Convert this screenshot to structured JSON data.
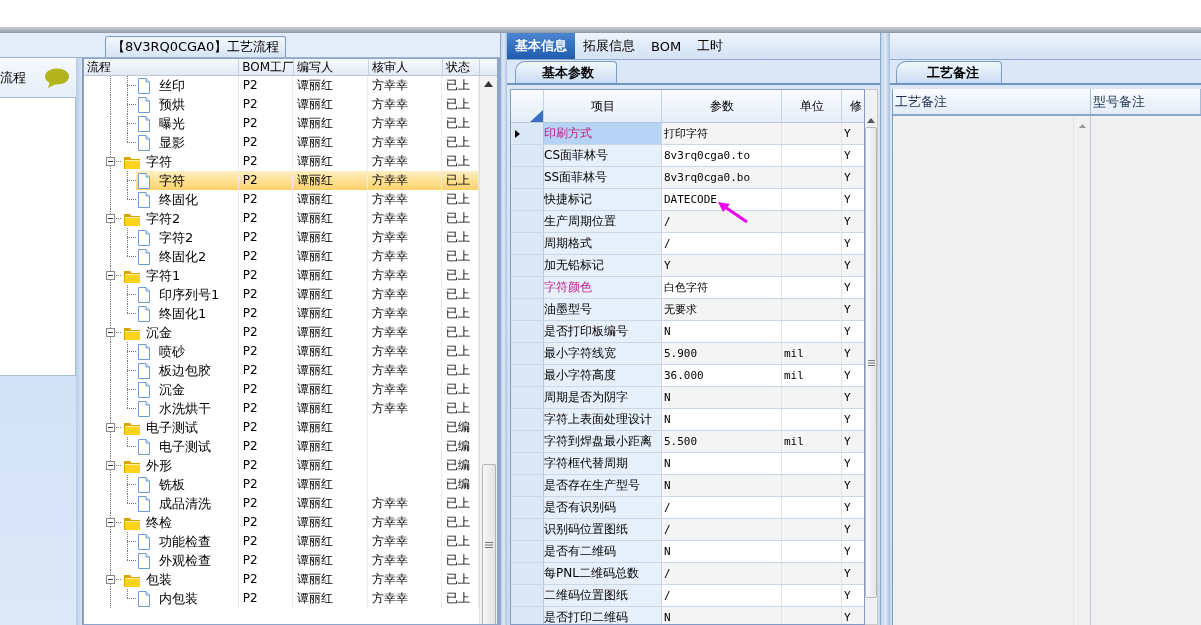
{
  "tree_tab": {
    "title": "【8V3RQ0CGA0】工艺流程"
  },
  "sidebar": {
    "title": "流程"
  },
  "tree": {
    "columns": [
      "流程",
      "BOM工厂",
      "编写人",
      "核审人",
      "状态"
    ],
    "rows": [
      {
        "kind": "continuation",
        "children": [
          {
            "label": "丝印",
            "factory": "P2",
            "writer": "谭丽红",
            "reviewer": "方幸幸",
            "status": "已上",
            "selected": false
          },
          {
            "label": "预烘",
            "factory": "P2",
            "writer": "谭丽红",
            "reviewer": "方幸幸",
            "status": "已上",
            "selected": false
          },
          {
            "label": "曝光",
            "factory": "P2",
            "writer": "谭丽红",
            "reviewer": "方幸幸",
            "status": "已上",
            "selected": false
          },
          {
            "label": "显影",
            "factory": "P2",
            "writer": "谭丽红",
            "reviewer": "方幸幸",
            "status": "已上",
            "selected": false
          }
        ]
      },
      {
        "kind": "folder",
        "label": "字符",
        "factory": "P2",
        "writer": "谭丽红",
        "reviewer": "方幸幸",
        "status": "已上",
        "selected": false,
        "children": [
          {
            "label": "字符",
            "factory": "P2",
            "writer": "谭丽红",
            "reviewer": "方幸幸",
            "status": "已上",
            "selected": true
          },
          {
            "label": "终固化",
            "factory": "P2",
            "writer": "谭丽红",
            "reviewer": "方幸幸",
            "status": "已上",
            "selected": false
          }
        ]
      },
      {
        "kind": "folder",
        "label": "字符2",
        "factory": "P2",
        "writer": "谭丽红",
        "reviewer": "方幸幸",
        "status": "已上",
        "selected": false,
        "children": [
          {
            "label": "字符2",
            "factory": "P2",
            "writer": "谭丽红",
            "reviewer": "方幸幸",
            "status": "已上",
            "selected": false
          },
          {
            "label": "终固化2",
            "factory": "P2",
            "writer": "谭丽红",
            "reviewer": "方幸幸",
            "status": "已上",
            "selected": false
          }
        ]
      },
      {
        "kind": "folder",
        "label": "字符1",
        "factory": "P2",
        "writer": "谭丽红",
        "reviewer": "方幸幸",
        "status": "已上",
        "selected": false,
        "children": [
          {
            "label": "印序列号1",
            "factory": "P2",
            "writer": "谭丽红",
            "reviewer": "方幸幸",
            "status": "已上",
            "selected": false
          },
          {
            "label": "终固化1",
            "factory": "P2",
            "writer": "谭丽红",
            "reviewer": "方幸幸",
            "status": "已上",
            "selected": false
          }
        ]
      },
      {
        "kind": "folder",
        "label": "沉金",
        "factory": "P2",
        "writer": "谭丽红",
        "reviewer": "方幸幸",
        "status": "已上",
        "selected": false,
        "children": [
          {
            "label": "喷砂",
            "factory": "P2",
            "writer": "谭丽红",
            "reviewer": "方幸幸",
            "status": "已上",
            "selected": false
          },
          {
            "label": "板边包胶",
            "factory": "P2",
            "writer": "谭丽红",
            "reviewer": "方幸幸",
            "status": "已上",
            "selected": false
          },
          {
            "label": "沉金",
            "factory": "P2",
            "writer": "谭丽红",
            "reviewer": "方幸幸",
            "status": "已上",
            "selected": false
          },
          {
            "label": "水洗烘干",
            "factory": "P2",
            "writer": "谭丽红",
            "reviewer": "方幸幸",
            "status": "已上",
            "selected": false
          }
        ]
      },
      {
        "kind": "folder",
        "label": "电子测试",
        "factory": "P2",
        "writer": "谭丽红",
        "status": "已编",
        "selected": false,
        "children": [
          {
            "label": "电子测试",
            "factory": "P2",
            "writer": "谭丽红",
            "status": "已编",
            "selected": false
          }
        ]
      },
      {
        "kind": "folder",
        "label": "外形",
        "factory": "P2",
        "writer": "谭丽红",
        "status": "已编",
        "selected": false,
        "children": [
          {
            "label": "铣板",
            "factory": "P2",
            "writer": "谭丽红",
            "status": "已编",
            "selected": false
          },
          {
            "label": "成品清洗",
            "factory": "P2",
            "writer": "谭丽红",
            "reviewer": "方幸幸",
            "status": "已上",
            "selected": false
          }
        ]
      },
      {
        "kind": "folder",
        "label": "终检",
        "factory": "P2",
        "writer": "谭丽红",
        "reviewer": "方幸幸",
        "status": "已上",
        "selected": false,
        "children": [
          {
            "label": "功能检查",
            "factory": "P2",
            "writer": "谭丽红",
            "reviewer": "方幸幸",
            "status": "已上",
            "selected": false
          },
          {
            "label": "外观检查",
            "factory": "P2",
            "writer": "谭丽红",
            "reviewer": "方幸幸",
            "status": "已上",
            "selected": false
          }
        ]
      },
      {
        "kind": "folder",
        "label": "包装",
        "factory": "P2",
        "writer": "谭丽红",
        "reviewer": "方幸幸",
        "status": "已上",
        "selected": false,
        "children": [
          {
            "label": "内包装",
            "factory": "P2",
            "writer": "谭丽红",
            "reviewer": "方幸幸",
            "status": "已上",
            "selected": false
          }
        ]
      }
    ]
  },
  "params": {
    "tabs": [
      {
        "label": "基本信息",
        "selected": true
      },
      {
        "label": "拓展信息",
        "selected": false
      },
      {
        "label": "BOM",
        "selected": false
      },
      {
        "label": "工时",
        "selected": false
      }
    ],
    "subtab": "基本参数",
    "columns": [
      "项目",
      "参数",
      "单位",
      "修"
    ],
    "rows": [
      {
        "item": "印刷方式",
        "value": "打印字符",
        "flag": "Y",
        "selected": true,
        "highlighted": true
      },
      {
        "item": "CS面菲林号",
        "value": "8v3rq0cga0.to",
        "flag": "Y",
        "selected": false,
        "highlighted": false
      },
      {
        "item": "SS面菲林号",
        "value": "8v3rq0cga0.bo",
        "flag": "Y",
        "selected": false,
        "highlighted": false
      },
      {
        "item": "快捷标记",
        "value": "DATECODE",
        "flag": "Y",
        "selected": false,
        "highlighted": false
      },
      {
        "item": "生产周期位置",
        "value": "/",
        "flag": "Y",
        "selected": false,
        "highlighted": false
      },
      {
        "item": "周期格式",
        "value": "/",
        "flag": "Y",
        "selected": false,
        "highlighted": false
      },
      {
        "item": "加无铅标记",
        "value": "Y",
        "flag": "Y",
        "selected": false,
        "highlighted": false
      },
      {
        "item": "字符颜色",
        "value": "白色字符",
        "flag": "Y",
        "selected": false,
        "highlighted": true
      },
      {
        "item": "油墨型号",
        "value": "无要求",
        "flag": "Y",
        "selected": false,
        "highlighted": false
      },
      {
        "item": "是否打印板编号",
        "value": "N",
        "flag": "Y",
        "selected": false,
        "highlighted": false
      },
      {
        "item": "最小字符线宽",
        "value": "5.900",
        "unit": "mil",
        "flag": "Y",
        "selected": false,
        "highlighted": false
      },
      {
        "item": "最小字符高度",
        "value": "36.000",
        "unit": "mil",
        "flag": "Y",
        "selected": false,
        "highlighted": false
      },
      {
        "item": "周期是否为阴字",
        "value": "N",
        "flag": "Y",
        "selected": false,
        "highlighted": false
      },
      {
        "item": "字符上表面处理设计",
        "value": "N",
        "flag": "Y",
        "selected": false,
        "highlighted": false
      },
      {
        "item": "字符到焊盘最小距离",
        "value": "5.500",
        "unit": "mil",
        "flag": "Y",
        "selected": false,
        "highlighted": false
      },
      {
        "item": "字符框代替周期",
        "value": "N",
        "flag": "Y",
        "selected": false,
        "highlighted": false
      },
      {
        "item": "是否存在生产型号",
        "value": "N",
        "flag": "Y",
        "selected": false,
        "highlighted": false
      },
      {
        "item": "是否有识别码",
        "value": "/",
        "flag": "Y",
        "selected": false,
        "highlighted": false
      },
      {
        "item": "识别码位置图纸",
        "value": "/",
        "flag": "Y",
        "selected": false,
        "highlighted": false
      },
      {
        "item": "是否有二维码",
        "value": "N",
        "flag": "Y",
        "selected": false,
        "highlighted": false
      },
      {
        "item": "每PNL二维码总数",
        "value": "/",
        "flag": "Y",
        "selected": false,
        "highlighted": false
      },
      {
        "item": "二维码位置图纸",
        "value": "/",
        "flag": "Y",
        "selected": false,
        "highlighted": false
      },
      {
        "item": "是否打印二维码",
        "value": "N",
        "flag": "Y",
        "selected": false,
        "highlighted": false
      }
    ]
  },
  "notes": {
    "subtab": "工艺备注",
    "columns": [
      "工艺备注",
      "型号备注"
    ]
  }
}
